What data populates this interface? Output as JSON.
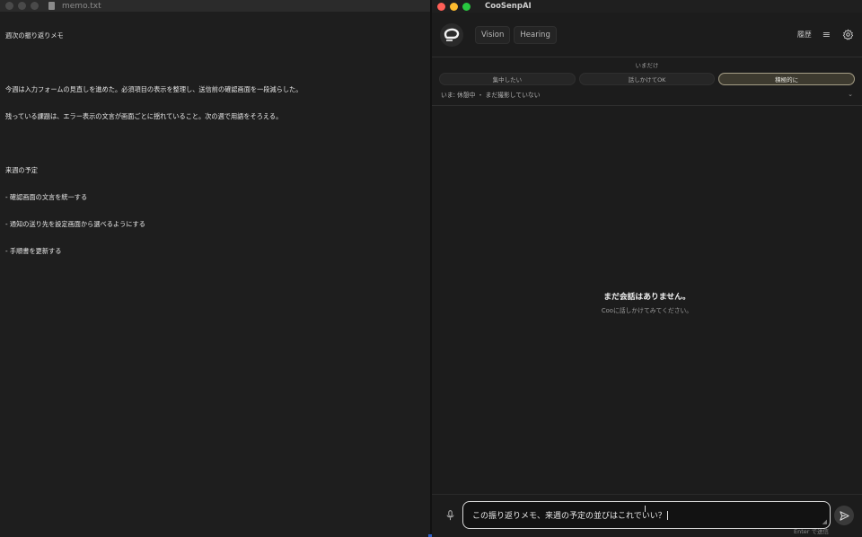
{
  "left_window": {
    "title": "memo.txt",
    "lines": [
      "週次の振り返りメモ",
      "",
      "今週は入力フォームの見直しを進めた。必須項目の表示を整理し、送信前の確認画面を一段減らした。",
      "残っている課題は、エラー表示の文言が画面ごとに揺れていること。次の週で用語をそろえる。",
      "",
      "来週の予定",
      "- 確認画面の文言を統一する",
      "- 通知の送り先を設定画面から選べるようにする",
      "- 手順書を更新する"
    ]
  },
  "app": {
    "title": "CooSenpAI",
    "nav": {
      "vision": "Vision",
      "hearing": "Hearing"
    },
    "history_label": "履歴",
    "mode": {
      "label": "いまだけ",
      "options": [
        "集中したい",
        "話しかけてOK",
        "積極的に"
      ],
      "selected": "積極的に"
    },
    "status": "いま: 休憩中 ・ まだ撮影していない",
    "empty_state": {
      "title": "まだ会話はありません。",
      "subtitle": "Cooに話しかけてみてください。"
    },
    "composer": {
      "value": "この振り返りメモ、来週の予定の並びはこれでいい？",
      "hint": "Enter で送信"
    }
  },
  "colors": {
    "accent_active_border": "#a59e86",
    "traffic_red": "#ff5f57",
    "traffic_yellow": "#febc2e",
    "traffic_green": "#28c840"
  }
}
